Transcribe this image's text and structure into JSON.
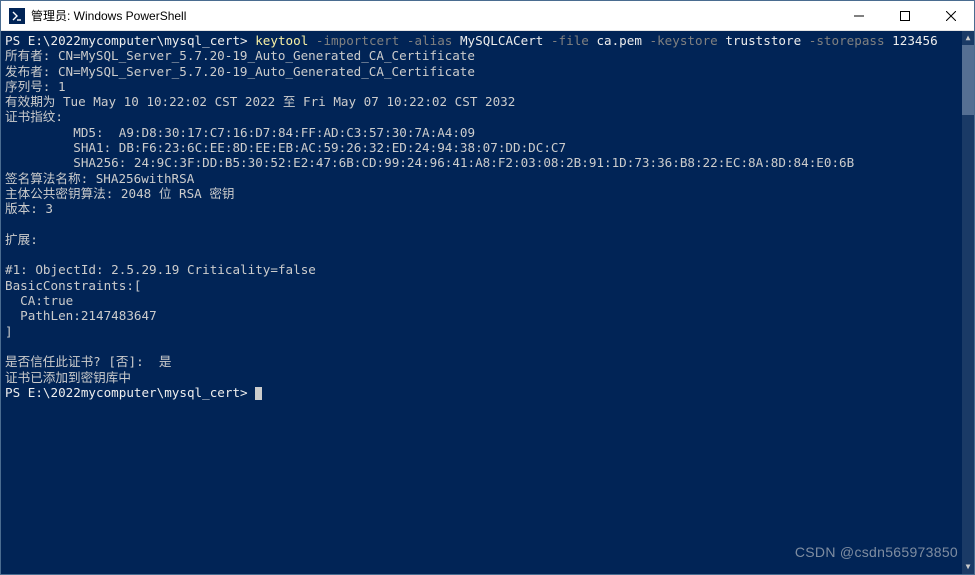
{
  "titlebar": {
    "title": "管理员: Windows PowerShell"
  },
  "cmd": {
    "prompt1": "PS E:\\2022mycomputer\\mysql_cert> ",
    "tool": "keytool",
    "arg_importcert": " -importcert ",
    "arg_alias": "-alias ",
    "alias_val": "MySQLCACert",
    "arg_file": " -file ",
    "file_val": "ca.pem",
    "arg_keystore": " -keystore ",
    "keystore_val": "truststore",
    "arg_storepass": " -storepass ",
    "storepass_val": "123456"
  },
  "out": {
    "line_owner": "所有者: CN=MySQL_Server_5.7.20-19_Auto_Generated_CA_Certificate",
    "line_issuer": "发布者: CN=MySQL_Server_5.7.20-19_Auto_Generated_CA_Certificate",
    "line_serial": "序列号: 1",
    "line_validity": "有效期为 Tue May 10 10:22:02 CST 2022 至 Fri May 07 10:22:02 CST 2032",
    "line_fingerprints": "证书指纹:",
    "line_md5": "         MD5:  A9:D8:30:17:C7:16:D7:84:FF:AD:C3:57:30:7A:A4:09",
    "line_sha1": "         SHA1: DB:F6:23:6C:EE:8D:EE:EB:AC:59:26:32:ED:24:94:38:07:DD:DC:C7",
    "line_sha256": "         SHA256: 24:9C:3F:DD:B5:30:52:E2:47:6B:CD:99:24:96:41:A8:F2:03:08:2B:91:1D:73:36:B8:22:EC:8A:8D:84:E0:6B",
    "line_sig_alg": "签名算法名称: SHA256withRSA",
    "line_pubkey": "主体公共密钥算法: 2048 位 RSA 密钥",
    "line_version": "版本: 3",
    "line_blank1": "",
    "line_ext_hdr": "扩展: ",
    "line_blank2": "",
    "line_ext_id": "#1: ObjectId: 2.5.29.19 Criticality=false",
    "line_bc": "BasicConstraints:[",
    "line_ca": "  CA:true",
    "line_pathlen": "  PathLen:2147483647",
    "line_bc_end": "]",
    "line_blank3": "",
    "line_trust_q": "是否信任此证书? [否]:  是",
    "line_added": "证书已添加到密钥库中",
    "prompt2": "PS E:\\2022mycomputer\\mysql_cert> "
  },
  "watermark": "CSDN @csdn565973850"
}
